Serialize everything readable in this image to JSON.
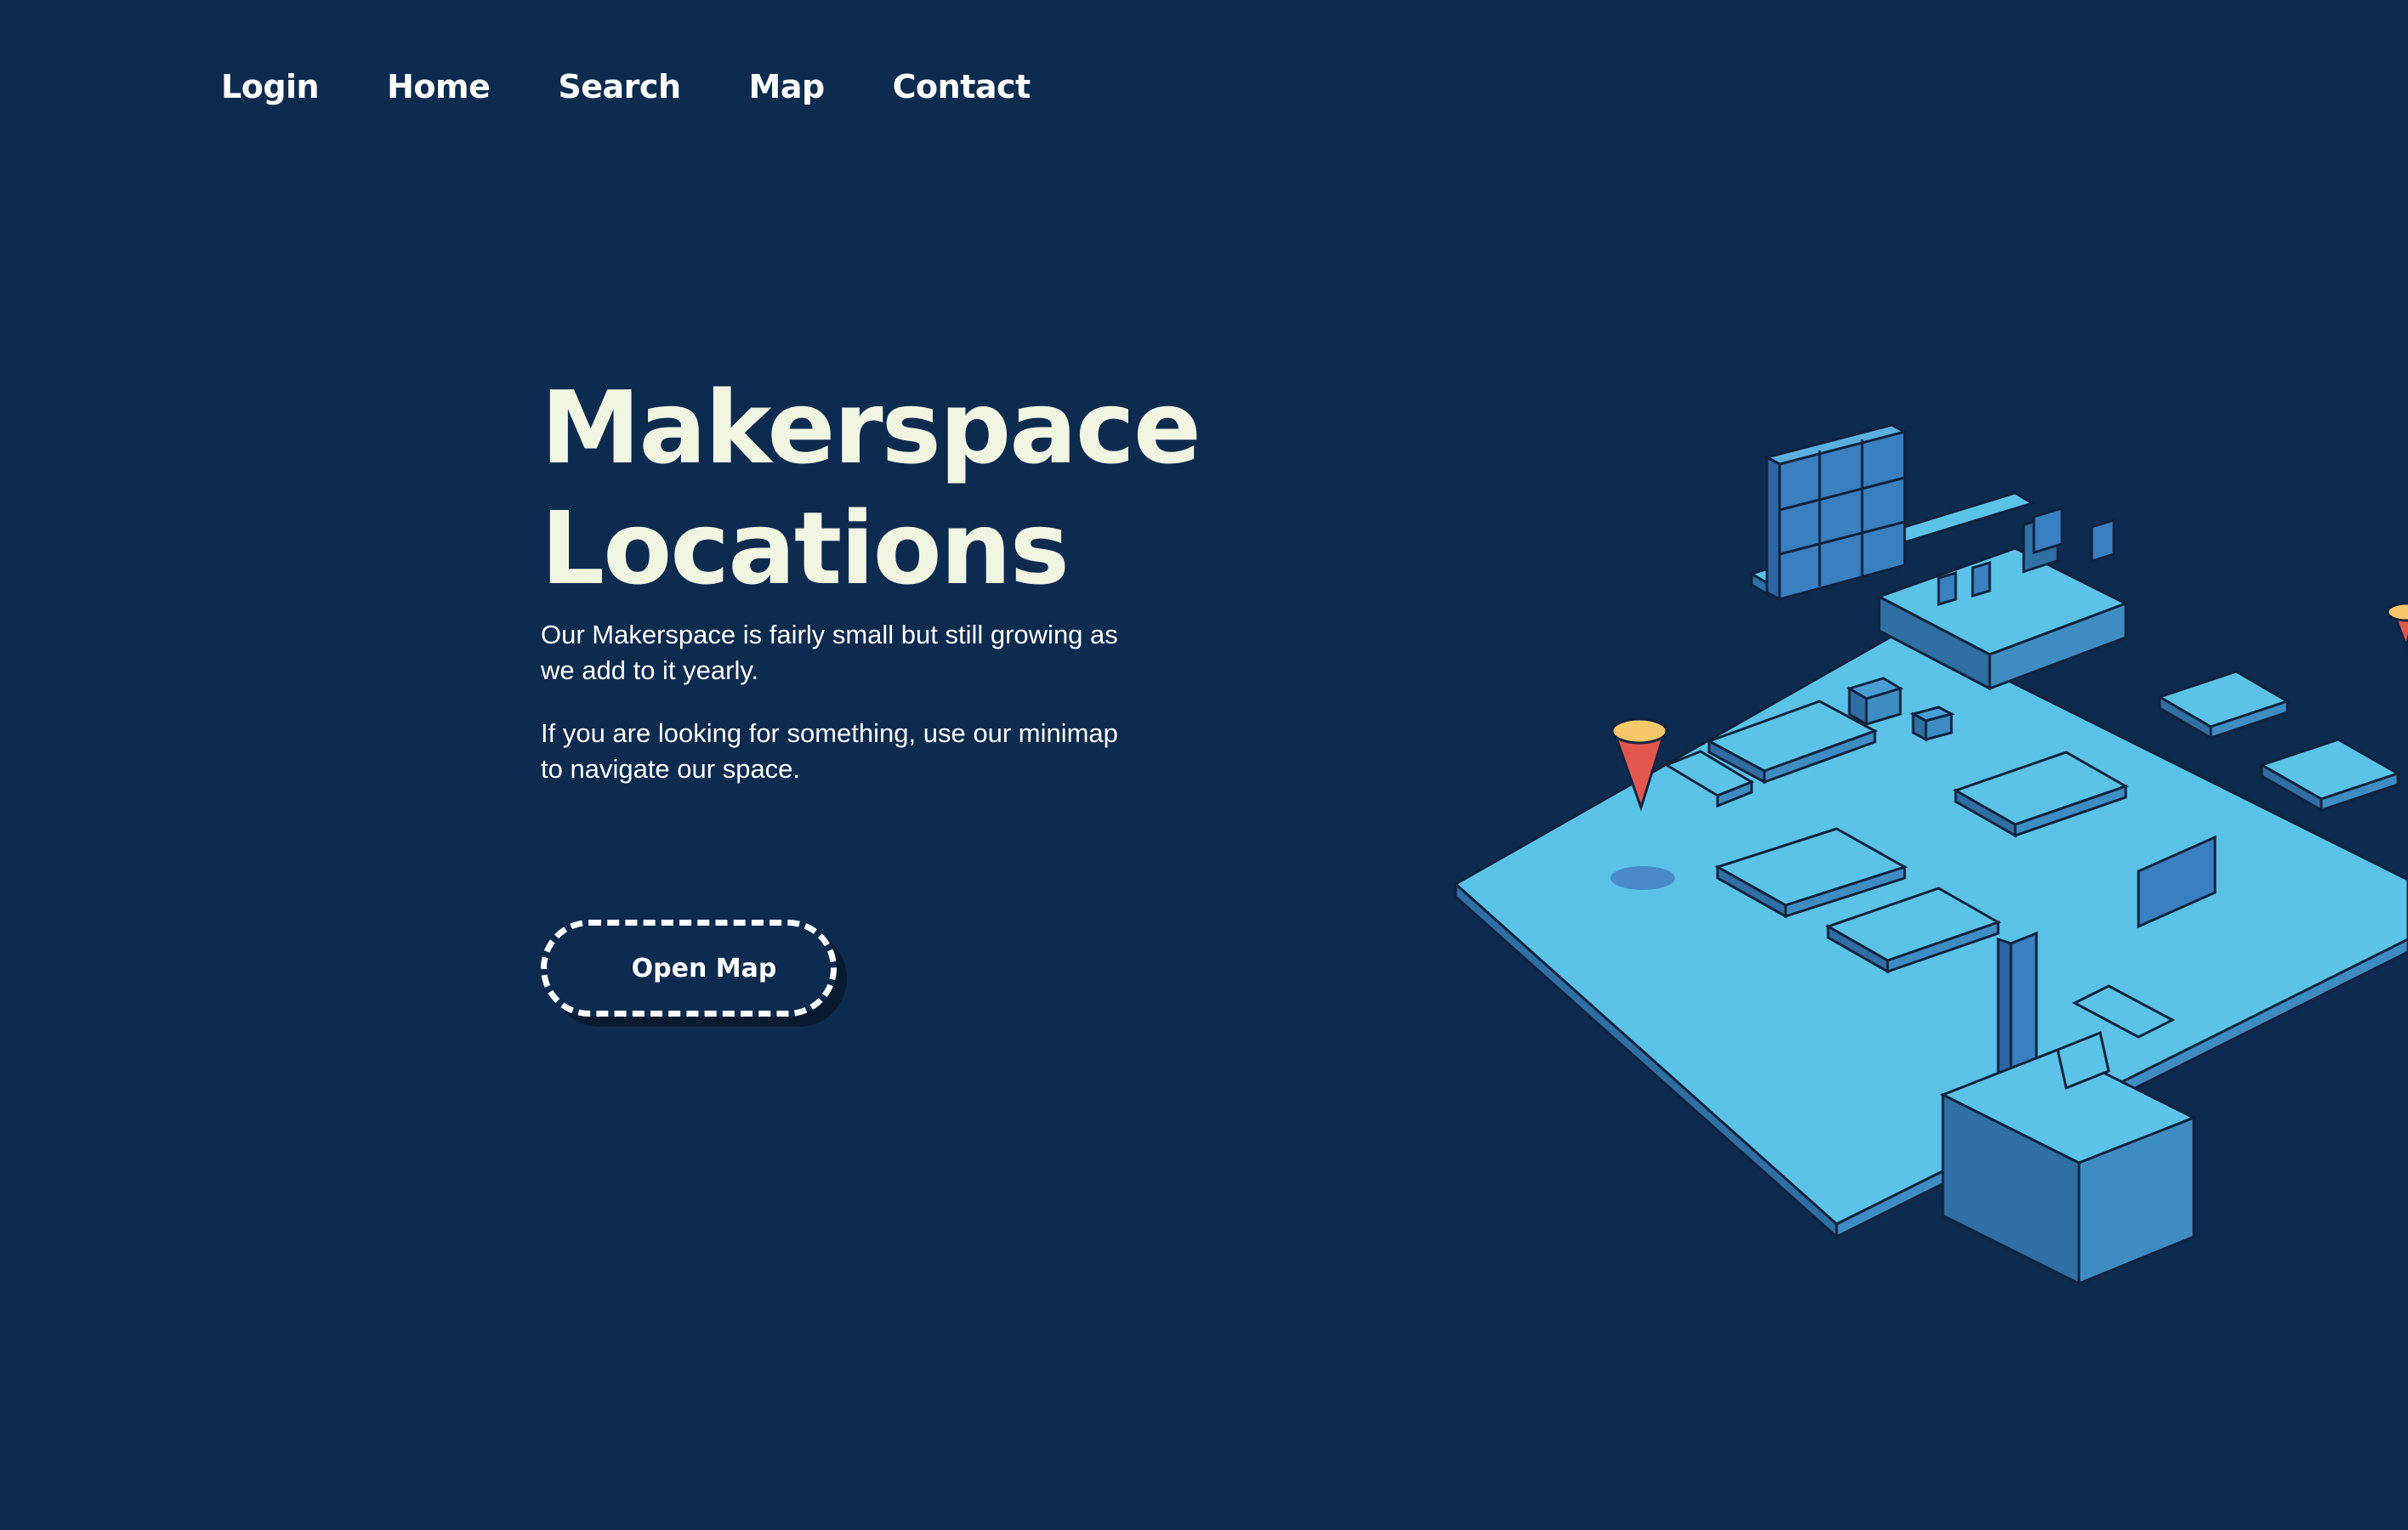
{
  "nav": {
    "items": [
      "Login",
      "Home",
      "Search",
      "Map",
      "Contact"
    ]
  },
  "hero": {
    "title_line1": "Makerspace",
    "title_line2": "Locations",
    "paragraph1": "Our Makerspace is fairly small but still growing as we add to it yearly.",
    "paragraph2": "If you are looking for something, use our minimap to navigate our space."
  },
  "cta": {
    "label": "Open Map"
  },
  "colors": {
    "background": "#0d2b4f",
    "title": "#f1f6e3",
    "floor": "#5bc2e8",
    "pin_top": "#f7c86a",
    "pin_cone": "#e2584f"
  }
}
